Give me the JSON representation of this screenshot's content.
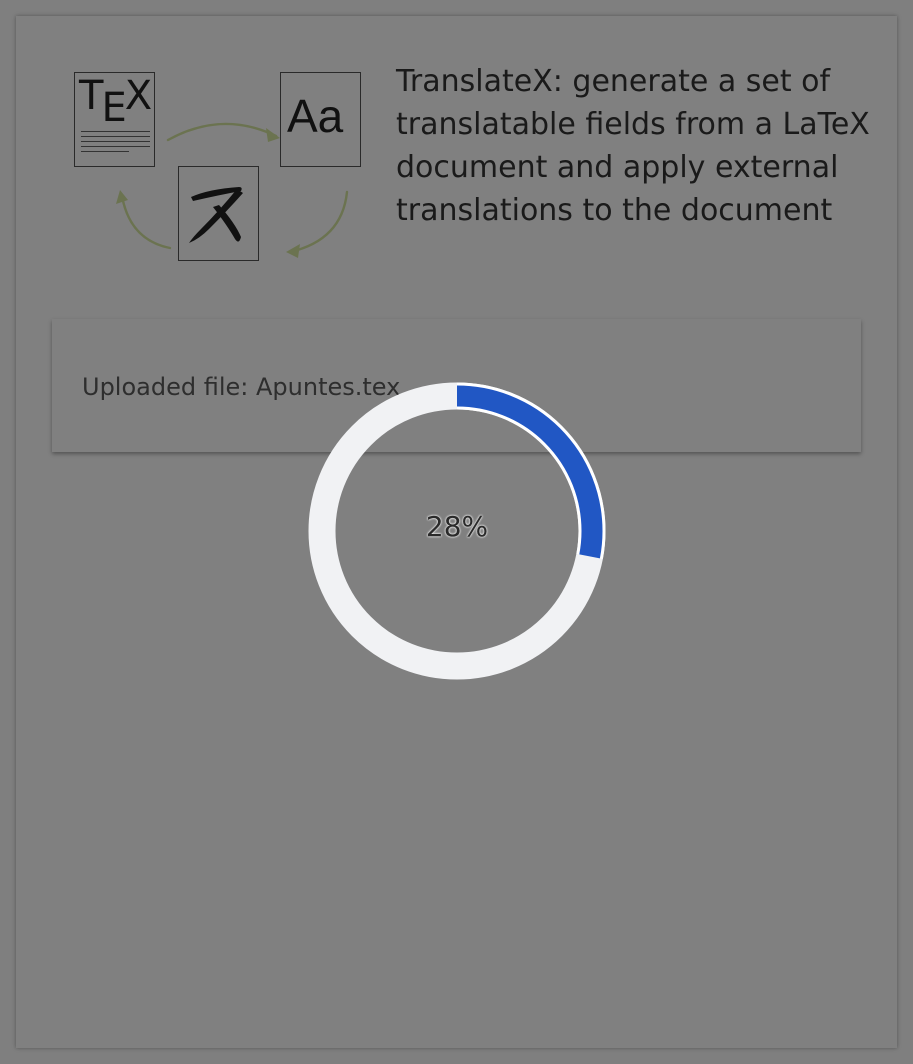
{
  "app": {
    "title": "TranslateX: generate a set of translatable fields from a LaTeX document and apply external translations to the document"
  },
  "logo": {
    "tex_label": "TEX",
    "aa_label": "Aa",
    "icons": [
      "tex-document-icon",
      "font-aa-icon",
      "japanese-character-icon",
      "cycle-arrows-icon"
    ],
    "arrow_color": "#6b7350"
  },
  "upload": {
    "label": "Uploaded file: Apuntes.tex"
  },
  "progress": {
    "value": 0.28,
    "label": "28%",
    "track_color": "#f1f2f4",
    "fill_color": "#2157c4"
  }
}
